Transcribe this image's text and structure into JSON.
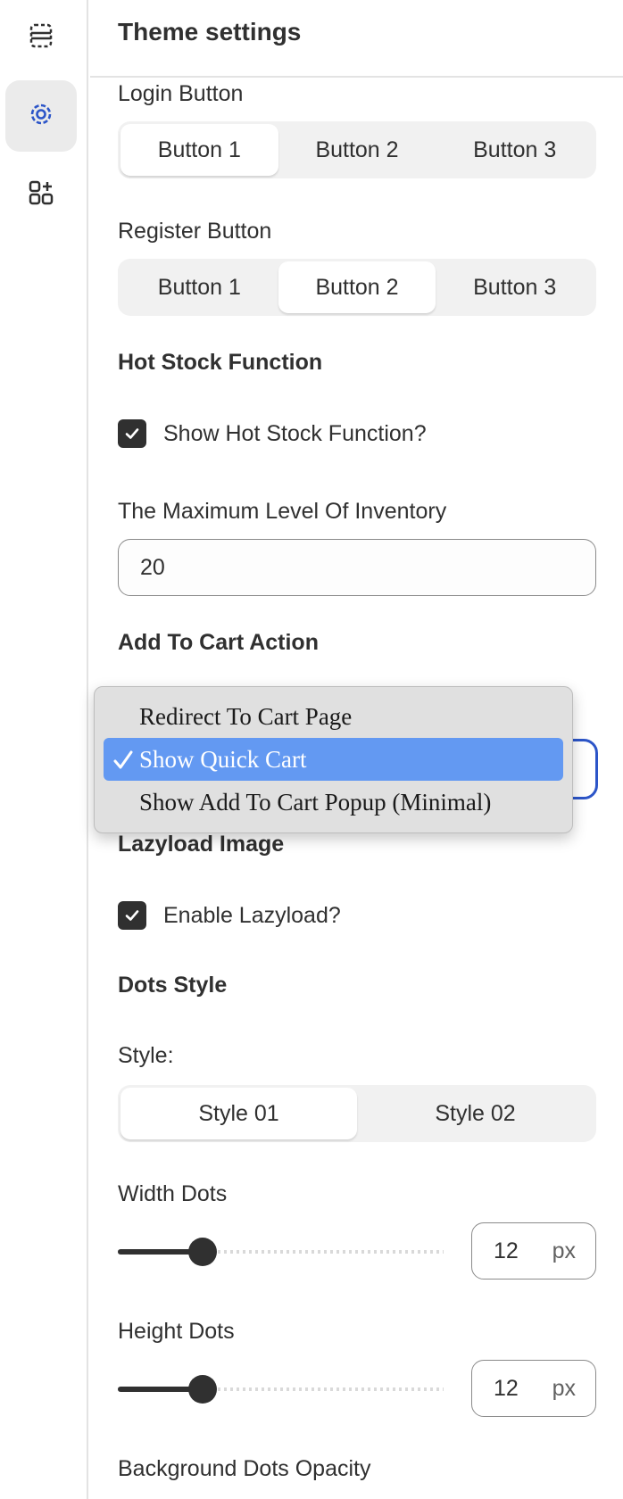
{
  "header": {
    "title": "Theme settings"
  },
  "rail": {
    "items": [
      {
        "icon": "sections-icon",
        "active": false
      },
      {
        "icon": "gear-icon",
        "active": true
      },
      {
        "icon": "apps-add-icon",
        "active": false
      }
    ]
  },
  "settings": {
    "login_button": {
      "label": "Login Button",
      "options": [
        "Button 1",
        "Button 2",
        "Button 3"
      ],
      "selected": "Button 1"
    },
    "register_button": {
      "label": "Register Button",
      "options": [
        "Button 1",
        "Button 2",
        "Button 3"
      ],
      "selected": "Button 2"
    },
    "hot_stock": {
      "heading": "Hot Stock Function",
      "checkbox_label": "Show Hot Stock Function?",
      "checked": true
    },
    "max_inventory": {
      "label": "The Maximum Level Of Inventory",
      "value": "20"
    },
    "add_to_cart": {
      "heading": "Add To Cart Action",
      "options": [
        "Redirect To Cart Page",
        "Show Quick Cart",
        "Show Add To Cart Popup (Minimal)"
      ],
      "selected": "Show Quick Cart"
    },
    "lazyload": {
      "heading": "Lazyload Image",
      "checkbox_label": "Enable Lazyload?",
      "checked": true
    },
    "dots_style": {
      "heading": "Dots Style",
      "label": "Style:",
      "options": [
        "Style 01",
        "Style 02"
      ],
      "selected": "Style 01"
    },
    "width_dots": {
      "label": "Width Dots",
      "value": "12",
      "unit": "px",
      "fraction": 0.26
    },
    "height_dots": {
      "label": "Height Dots",
      "value": "12",
      "unit": "px",
      "fraction": 0.26
    },
    "background_dots_opacity": {
      "label": "Background Dots Opacity"
    }
  }
}
